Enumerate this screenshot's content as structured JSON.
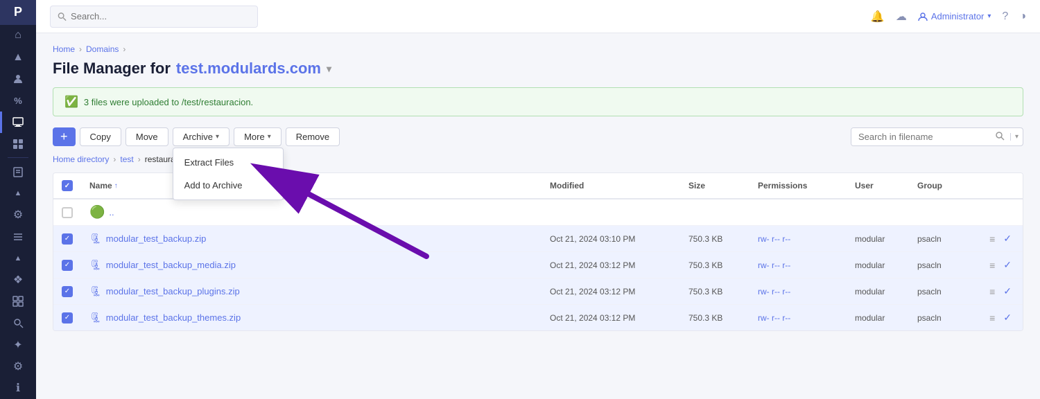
{
  "app": {
    "logo": "P"
  },
  "topbar": {
    "search_placeholder": "Search...",
    "user_name": "Administrator",
    "user_chevron": "▾"
  },
  "breadcrumb": {
    "home": "Home",
    "separator1": "›",
    "domains": "Domains",
    "separator2": "›"
  },
  "page_title": {
    "prefix": "File Manager for",
    "domain": "test.modulards.com",
    "chevron": "▾"
  },
  "success_banner": {
    "message": "3 files were uploaded to /test/restauracion."
  },
  "toolbar": {
    "add_label": "+",
    "copy_label": "Copy",
    "move_label": "Move",
    "archive_label": "Archive",
    "archive_chevron": "▾",
    "more_label": "More",
    "more_chevron": "▾",
    "remove_label": "Remove",
    "search_placeholder": "Search in filename"
  },
  "archive_dropdown": {
    "items": [
      {
        "label": "Extract Files",
        "id": "extract-files"
      },
      {
        "label": "Add to Archive",
        "id": "add-to-archive"
      }
    ]
  },
  "path": {
    "home_dir": "Home directory",
    "sep1": "›",
    "test": "test",
    "sep2": "›",
    "current": "restauracion"
  },
  "table": {
    "headers": {
      "name": "Name",
      "sort_indicator": "↑",
      "modified": "Modified",
      "size": "Size",
      "permissions": "Permissions",
      "user": "User",
      "group": "Group"
    },
    "rows": [
      {
        "id": "parent",
        "checked": false,
        "icon": "📁",
        "name": "..",
        "is_parent": true,
        "modified": "",
        "size": "",
        "permissions": "",
        "user": "",
        "group": ""
      },
      {
        "id": "row1",
        "checked": true,
        "icon": "🗜",
        "name": "modular_test_backup.zip",
        "modified": "Oct 21, 2024 03:10 PM",
        "size": "750.3 KB",
        "permissions": "rw- r-- r--",
        "user": "modular",
        "group": "psacln"
      },
      {
        "id": "row2",
        "checked": true,
        "icon": "🗜",
        "name": "modular_test_backup_media.zip",
        "modified": "Oct 21, 2024 03:12 PM",
        "size": "750.3 KB",
        "permissions": "rw- r-- r--",
        "user": "modular",
        "group": "psacln"
      },
      {
        "id": "row3",
        "checked": true,
        "icon": "🗜",
        "name": "modular_test_backup_plugins.zip",
        "modified": "Oct 21, 2024 03:12 PM",
        "size": "750.3 KB",
        "permissions": "rw- r-- r--",
        "user": "modular",
        "group": "psacln"
      },
      {
        "id": "row4",
        "checked": true,
        "icon": "🗜",
        "name": "modular_test_backup_themes.zip",
        "modified": "Oct 21, 2024 03:12 PM",
        "size": "750.3 KB",
        "permissions": "rw- r-- r--",
        "user": "modular",
        "group": "psacln"
      }
    ]
  },
  "sidebar_icons": [
    {
      "name": "home-icon",
      "glyph": "⌂",
      "active": false
    },
    {
      "name": "up-icon",
      "glyph": "▲",
      "active": false
    },
    {
      "name": "user-icon",
      "glyph": "👤",
      "active": false
    },
    {
      "name": "percent-icon",
      "glyph": "%",
      "active": false
    },
    {
      "name": "monitor-icon",
      "glyph": "▣",
      "active": true
    },
    {
      "name": "apps-icon",
      "glyph": "⊞",
      "active": false
    },
    {
      "name": "book-icon",
      "glyph": "≡",
      "active": false
    },
    {
      "name": "collapse-icon",
      "glyph": "▲",
      "active": false
    },
    {
      "name": "gear-icon",
      "glyph": "⚙",
      "active": false
    },
    {
      "name": "list-icon",
      "glyph": "≔",
      "active": false
    },
    {
      "name": "collapse2-icon",
      "glyph": "▲",
      "active": false
    },
    {
      "name": "extensions-icon",
      "glyph": "❖",
      "active": false
    },
    {
      "name": "grid-icon",
      "glyph": "⊟",
      "active": false
    },
    {
      "name": "search2-icon",
      "glyph": "🔍",
      "active": false
    },
    {
      "name": "star-icon",
      "glyph": "✦",
      "active": false
    },
    {
      "name": "settings2-icon",
      "glyph": "⚙",
      "active": false
    },
    {
      "name": "info-icon",
      "glyph": "ℹ",
      "active": false
    }
  ],
  "colors": {
    "accent": "#5b73e8",
    "success": "#4caf50",
    "sidebar_bg": "#1a1f36"
  }
}
